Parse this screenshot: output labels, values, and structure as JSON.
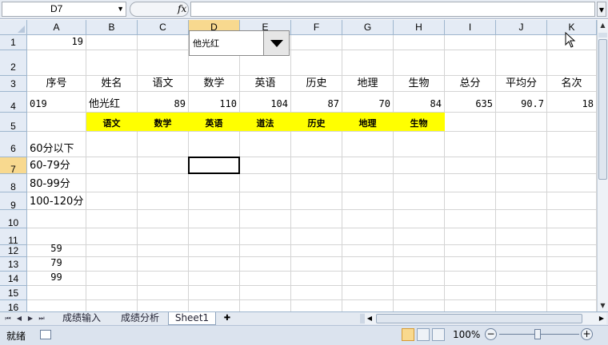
{
  "formula_bar": {
    "name_box": "D7",
    "fx_label": "fx",
    "formula": ""
  },
  "columns": [
    "A",
    "B",
    "C",
    "D",
    "E",
    "F",
    "G",
    "H",
    "I",
    "J",
    "K"
  ],
  "selected_column": "D",
  "rows": [
    "1",
    "2",
    "3",
    "4",
    "5",
    "6",
    "7",
    "8",
    "9",
    "10",
    "11",
    "12",
    "13",
    "14",
    "15",
    "16"
  ],
  "selected_row": "7",
  "cells": {
    "A1": "19",
    "A3": "序号",
    "B3": "姓名",
    "C3": "语文",
    "D3": "数学",
    "E3": "英语",
    "F3": "历史",
    "G3": "地理",
    "H3": "生物",
    "I3": "总分",
    "J3": "平均分",
    "K3": "名次",
    "A4": "019",
    "B4": "他光红",
    "C4": "89",
    "D4": "110",
    "E4": "104",
    "F4": "87",
    "G4": "70",
    "H4": "84",
    "I4": "635",
    "J4": "90.7",
    "K4": "18",
    "B5": "语文",
    "C5": "数学",
    "D5": "英语",
    "E5": "道法",
    "F5": "历史",
    "G5": "地理",
    "H5": "生物",
    "A6": "60分以下",
    "A7": "60-79分",
    "A8": "80-99分",
    "A9": "100-120分",
    "A12": "59",
    "A13": "79",
    "A14": "99"
  },
  "dropdown": {
    "value": "他光红"
  },
  "sheet_tabs": [
    "成绩输入",
    "成绩分析",
    "Sheet1"
  ],
  "active_tab": "Sheet1",
  "status": {
    "ready": "就绪",
    "zoom": "100%"
  },
  "colors": {
    "highlight": "#ffff00",
    "selected_header": "#f8d98f",
    "header_bg": "#e4ebf5"
  }
}
